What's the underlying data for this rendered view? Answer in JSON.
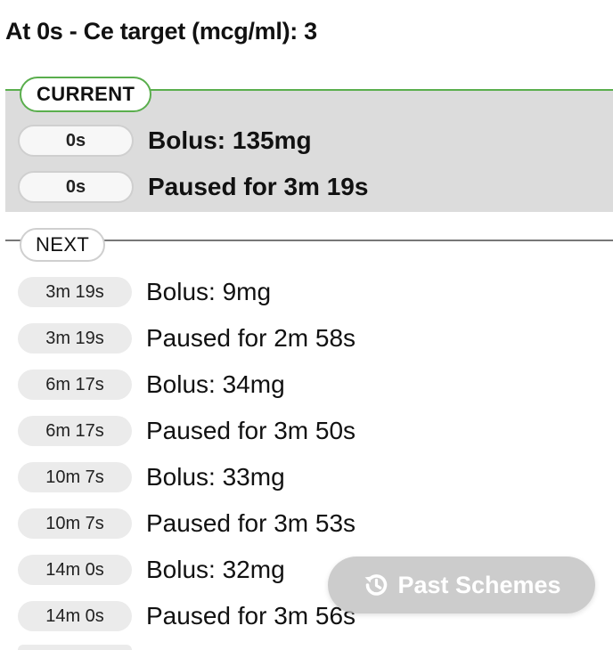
{
  "header": {
    "title": "At 0s - Ce target (mcg/ml): 3"
  },
  "current": {
    "badge": "CURRENT",
    "steps": [
      {
        "time": "0s",
        "text": "Bolus: 135mg"
      },
      {
        "time": "0s",
        "text": "Paused for 3m 19s"
      }
    ]
  },
  "next": {
    "badge": "NEXT",
    "steps": [
      {
        "time": "3m 19s",
        "text": "Bolus: 9mg"
      },
      {
        "time": "3m 19s",
        "text": "Paused for 2m 58s"
      },
      {
        "time": "6m 17s",
        "text": "Bolus: 34mg"
      },
      {
        "time": "6m 17s",
        "text": "Paused for 3m 50s"
      },
      {
        "time": "10m 7s",
        "text": "Bolus: 33mg"
      },
      {
        "time": "10m 7s",
        "text": "Paused for 3m 53s"
      },
      {
        "time": "14m 0s",
        "text": "Bolus: 32mg"
      },
      {
        "time": "14m 0s",
        "text": "Paused for 3m 56s"
      }
    ]
  },
  "past_schemes_button": {
    "label": "Past Schemes",
    "icon": "history-icon"
  },
  "colors": {
    "current_accent": "#5aae4d",
    "current_background": "#dcdcdc",
    "pill_background": "#ebebeb",
    "button_background": "#bebebe"
  }
}
